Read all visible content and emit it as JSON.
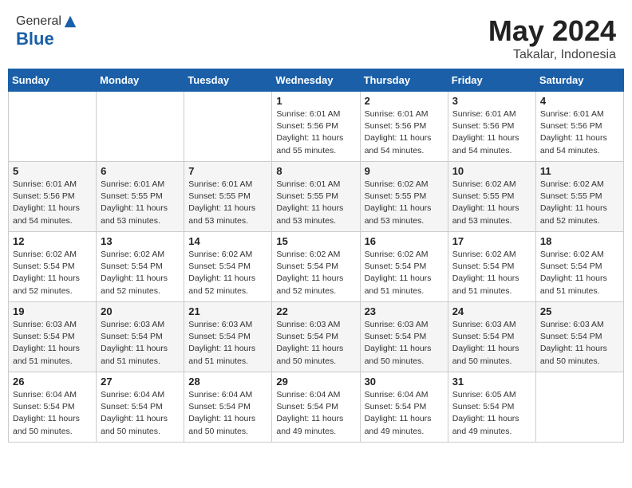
{
  "header": {
    "logo_line1": "General",
    "logo_line2": "Blue",
    "title": "May 2024",
    "location": "Takalar, Indonesia"
  },
  "weekdays": [
    "Sunday",
    "Monday",
    "Tuesday",
    "Wednesday",
    "Thursday",
    "Friday",
    "Saturday"
  ],
  "weeks": [
    [
      {
        "day": "",
        "info": ""
      },
      {
        "day": "",
        "info": ""
      },
      {
        "day": "",
        "info": ""
      },
      {
        "day": "1",
        "info": "Sunrise: 6:01 AM\nSunset: 5:56 PM\nDaylight: 11 hours and 55 minutes."
      },
      {
        "day": "2",
        "info": "Sunrise: 6:01 AM\nSunset: 5:56 PM\nDaylight: 11 hours and 54 minutes."
      },
      {
        "day": "3",
        "info": "Sunrise: 6:01 AM\nSunset: 5:56 PM\nDaylight: 11 hours and 54 minutes."
      },
      {
        "day": "4",
        "info": "Sunrise: 6:01 AM\nSunset: 5:56 PM\nDaylight: 11 hours and 54 minutes."
      }
    ],
    [
      {
        "day": "5",
        "info": "Sunrise: 6:01 AM\nSunset: 5:56 PM\nDaylight: 11 hours and 54 minutes."
      },
      {
        "day": "6",
        "info": "Sunrise: 6:01 AM\nSunset: 5:55 PM\nDaylight: 11 hours and 53 minutes."
      },
      {
        "day": "7",
        "info": "Sunrise: 6:01 AM\nSunset: 5:55 PM\nDaylight: 11 hours and 53 minutes."
      },
      {
        "day": "8",
        "info": "Sunrise: 6:01 AM\nSunset: 5:55 PM\nDaylight: 11 hours and 53 minutes."
      },
      {
        "day": "9",
        "info": "Sunrise: 6:02 AM\nSunset: 5:55 PM\nDaylight: 11 hours and 53 minutes."
      },
      {
        "day": "10",
        "info": "Sunrise: 6:02 AM\nSunset: 5:55 PM\nDaylight: 11 hours and 53 minutes."
      },
      {
        "day": "11",
        "info": "Sunrise: 6:02 AM\nSunset: 5:55 PM\nDaylight: 11 hours and 52 minutes."
      }
    ],
    [
      {
        "day": "12",
        "info": "Sunrise: 6:02 AM\nSunset: 5:54 PM\nDaylight: 11 hours and 52 minutes."
      },
      {
        "day": "13",
        "info": "Sunrise: 6:02 AM\nSunset: 5:54 PM\nDaylight: 11 hours and 52 minutes."
      },
      {
        "day": "14",
        "info": "Sunrise: 6:02 AM\nSunset: 5:54 PM\nDaylight: 11 hours and 52 minutes."
      },
      {
        "day": "15",
        "info": "Sunrise: 6:02 AM\nSunset: 5:54 PM\nDaylight: 11 hours and 52 minutes."
      },
      {
        "day": "16",
        "info": "Sunrise: 6:02 AM\nSunset: 5:54 PM\nDaylight: 11 hours and 51 minutes."
      },
      {
        "day": "17",
        "info": "Sunrise: 6:02 AM\nSunset: 5:54 PM\nDaylight: 11 hours and 51 minutes."
      },
      {
        "day": "18",
        "info": "Sunrise: 6:02 AM\nSunset: 5:54 PM\nDaylight: 11 hours and 51 minutes."
      }
    ],
    [
      {
        "day": "19",
        "info": "Sunrise: 6:03 AM\nSunset: 5:54 PM\nDaylight: 11 hours and 51 minutes."
      },
      {
        "day": "20",
        "info": "Sunrise: 6:03 AM\nSunset: 5:54 PM\nDaylight: 11 hours and 51 minutes."
      },
      {
        "day": "21",
        "info": "Sunrise: 6:03 AM\nSunset: 5:54 PM\nDaylight: 11 hours and 51 minutes."
      },
      {
        "day": "22",
        "info": "Sunrise: 6:03 AM\nSunset: 5:54 PM\nDaylight: 11 hours and 50 minutes."
      },
      {
        "day": "23",
        "info": "Sunrise: 6:03 AM\nSunset: 5:54 PM\nDaylight: 11 hours and 50 minutes."
      },
      {
        "day": "24",
        "info": "Sunrise: 6:03 AM\nSunset: 5:54 PM\nDaylight: 11 hours and 50 minutes."
      },
      {
        "day": "25",
        "info": "Sunrise: 6:03 AM\nSunset: 5:54 PM\nDaylight: 11 hours and 50 minutes."
      }
    ],
    [
      {
        "day": "26",
        "info": "Sunrise: 6:04 AM\nSunset: 5:54 PM\nDaylight: 11 hours and 50 minutes."
      },
      {
        "day": "27",
        "info": "Sunrise: 6:04 AM\nSunset: 5:54 PM\nDaylight: 11 hours and 50 minutes."
      },
      {
        "day": "28",
        "info": "Sunrise: 6:04 AM\nSunset: 5:54 PM\nDaylight: 11 hours and 50 minutes."
      },
      {
        "day": "29",
        "info": "Sunrise: 6:04 AM\nSunset: 5:54 PM\nDaylight: 11 hours and 49 minutes."
      },
      {
        "day": "30",
        "info": "Sunrise: 6:04 AM\nSunset: 5:54 PM\nDaylight: 11 hours and 49 minutes."
      },
      {
        "day": "31",
        "info": "Sunrise: 6:05 AM\nSunset: 5:54 PM\nDaylight: 11 hours and 49 minutes."
      },
      {
        "day": "",
        "info": ""
      }
    ]
  ]
}
